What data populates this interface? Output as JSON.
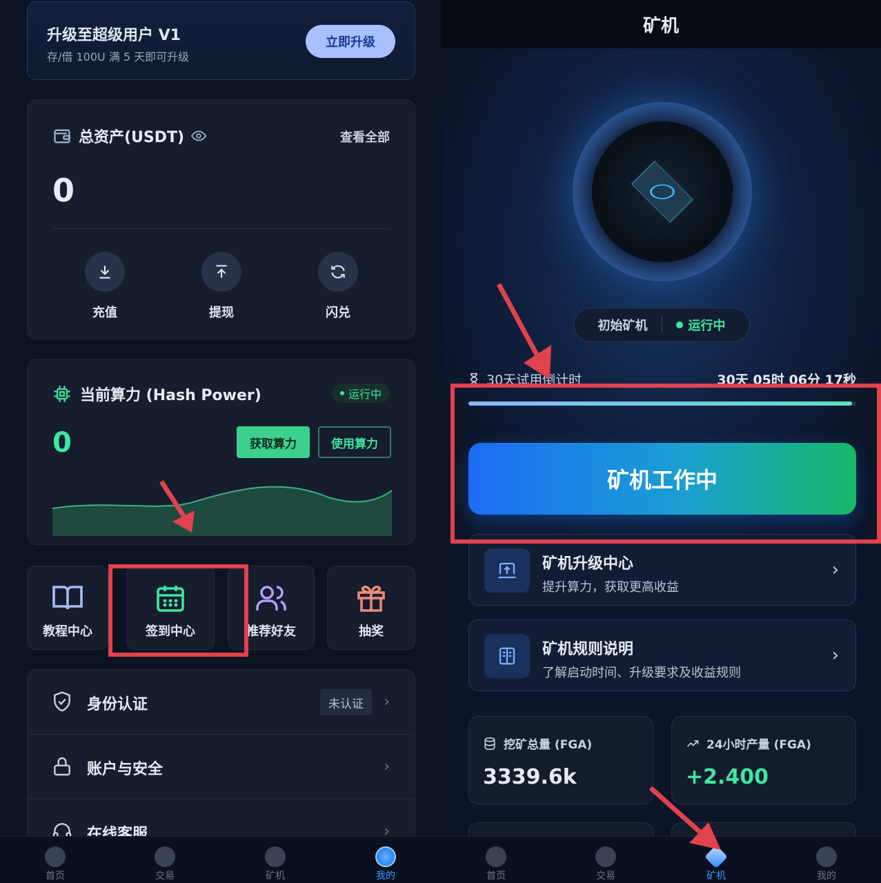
{
  "left": {
    "upgrade": {
      "title": "升级至超级用户 V1",
      "subtitle": "存/借 100U 满 5 天即可升级",
      "button": "立即升级"
    },
    "assets": {
      "title": "总资产(USDT)",
      "view_all": "查看全部",
      "value": "0",
      "actions": [
        {
          "label": "充值",
          "icon": "download-icon"
        },
        {
          "label": "提现",
          "icon": "upload-icon"
        },
        {
          "label": "闪兑",
          "icon": "refresh-icon"
        }
      ]
    },
    "hash": {
      "title": "当前算力 (Hash Power)",
      "status": "运行中",
      "value": "0",
      "get_button": "获取算力",
      "use_button": "使用算力"
    },
    "quick": [
      {
        "label": "教程中心",
        "icon": "book-icon"
      },
      {
        "label": "签到中心",
        "icon": "calendar-icon"
      },
      {
        "label": "推荐好友",
        "icon": "users-icon"
      },
      {
        "label": "抽奖",
        "icon": "gift-icon"
      }
    ],
    "list": [
      {
        "label": "身份认证",
        "tag": "未认证",
        "icon": "shield-icon"
      },
      {
        "label": "账户与安全",
        "icon": "lock-icon"
      },
      {
        "label": "在线客服",
        "icon": "headset-icon"
      }
    ],
    "nav": [
      "首页",
      "交易",
      "矿机",
      "我的"
    ],
    "nav_active": "我的"
  },
  "right": {
    "title": "矿机",
    "machine_name": "初始矿机",
    "machine_status": "运行中",
    "trial_label": "30天试用倒计时",
    "countdown": "30天 05时 06分 17秒",
    "progress": 0.99,
    "work_button": "矿机工作中",
    "menus": [
      {
        "title": "矿机升级中心",
        "subtitle": "提升算力，获取更高收益",
        "icon": "upgrade-icon"
      },
      {
        "title": "矿机规则说明",
        "subtitle": "了解启动时间、升级要求及收益规则",
        "icon": "book-icon"
      }
    ],
    "stats": [
      {
        "title": "挖矿总量 (FGA)",
        "value": "3339.6k",
        "icon": "database-icon"
      },
      {
        "title": "24小时产量 (FGA)",
        "value": "+2.400",
        "icon": "trend-icon",
        "color": "#3ee6a0"
      }
    ],
    "nav": [
      "首页",
      "交易",
      "矿机",
      "我的"
    ],
    "nav_active": "矿机"
  },
  "colors": {
    "accent_green": "#3ee6a0",
    "accent_blue": "#1d6cf5",
    "annotation_red": "#e0424e"
  }
}
